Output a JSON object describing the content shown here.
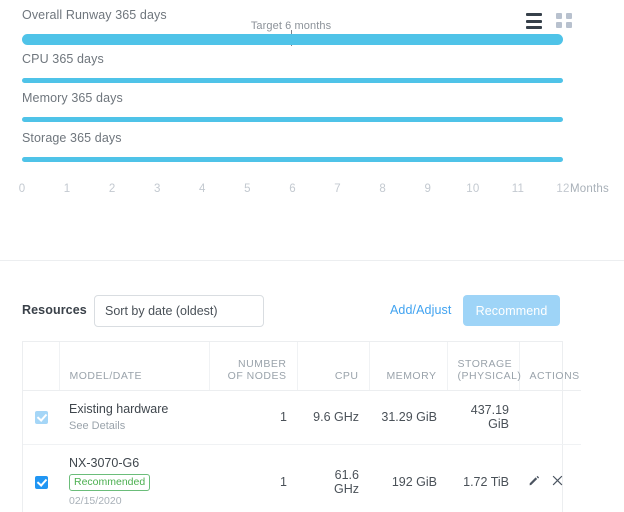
{
  "chart": {
    "toolbar": {
      "list_view_icon": "list-icon",
      "grid_view_icon": "grid-icon"
    },
    "target_label": "Target 6 months",
    "axis_units": "Months",
    "rows": [
      {
        "label": "Overall Runway 365 days",
        "bar_pct": 100
      },
      {
        "label": "CPU 365 days",
        "bar_pct": 100
      },
      {
        "label": "Memory 365 days",
        "bar_pct": 100
      },
      {
        "label": "Storage 365 days",
        "bar_pct": 100
      }
    ],
    "axis_ticks": [
      "0",
      "1",
      "2",
      "3",
      "4",
      "5",
      "6",
      "7",
      "8",
      "9",
      "10",
      "11",
      "12"
    ],
    "accent_color": "#4fc3e8"
  },
  "chart_data": {
    "type": "bar",
    "title": "Capacity Runway",
    "orientation": "horizontal",
    "categories": [
      "Overall Runway 365 days",
      "CPU 365 days",
      "Memory 365 days",
      "Storage 365 days"
    ],
    "values": [
      12,
      12,
      12,
      12
    ],
    "value_labels": [
      "365 days",
      "365 days",
      "365 days",
      "365 days"
    ],
    "xlabel": "Months",
    "ylabel": "",
    "xlim": [
      0,
      12
    ],
    "xticks": [
      0,
      1,
      2,
      3,
      4,
      5,
      6,
      7,
      8,
      9,
      10,
      11,
      12
    ],
    "grid": false,
    "legend": "none",
    "annotations": [
      {
        "text": "Target 6 months",
        "x": 6,
        "type": "vertical-marker"
      }
    ],
    "series_color": "#4fc3e8"
  },
  "resources": {
    "title": "Resources",
    "sort": {
      "selected": "Sort by date (oldest)",
      "options": [
        "Sort by date (oldest)"
      ]
    },
    "add_adjust_label": "Add/Adjust",
    "recommend_label": "Recommend",
    "table": {
      "headers": {
        "checkbox": "",
        "model_date": "MODEL/DATE",
        "nodes": "NUMBER OF NODES",
        "cpu": "CPU",
        "memory": "MEMORY",
        "storage": "STORAGE (PHYSICAL)",
        "actions": "ACTIONS"
      },
      "rows": [
        {
          "checked": true,
          "name": "Existing hardware",
          "sub_link": "See Details",
          "badge": "",
          "date": "",
          "nodes": "1",
          "cpu": "9.6 GHz",
          "memory": "31.29 GiB",
          "storage": "437.19 GiB",
          "actions": []
        },
        {
          "checked": true,
          "name": "NX-3070-G6",
          "sub_link": "",
          "badge": "Recommended",
          "date": "02/15/2020",
          "nodes": "1",
          "cpu": "61.6 GHz",
          "memory": "192 GiB",
          "storage": "1.72 TiB",
          "actions": [
            "edit-icon",
            "delete-icon"
          ]
        }
      ]
    }
  }
}
